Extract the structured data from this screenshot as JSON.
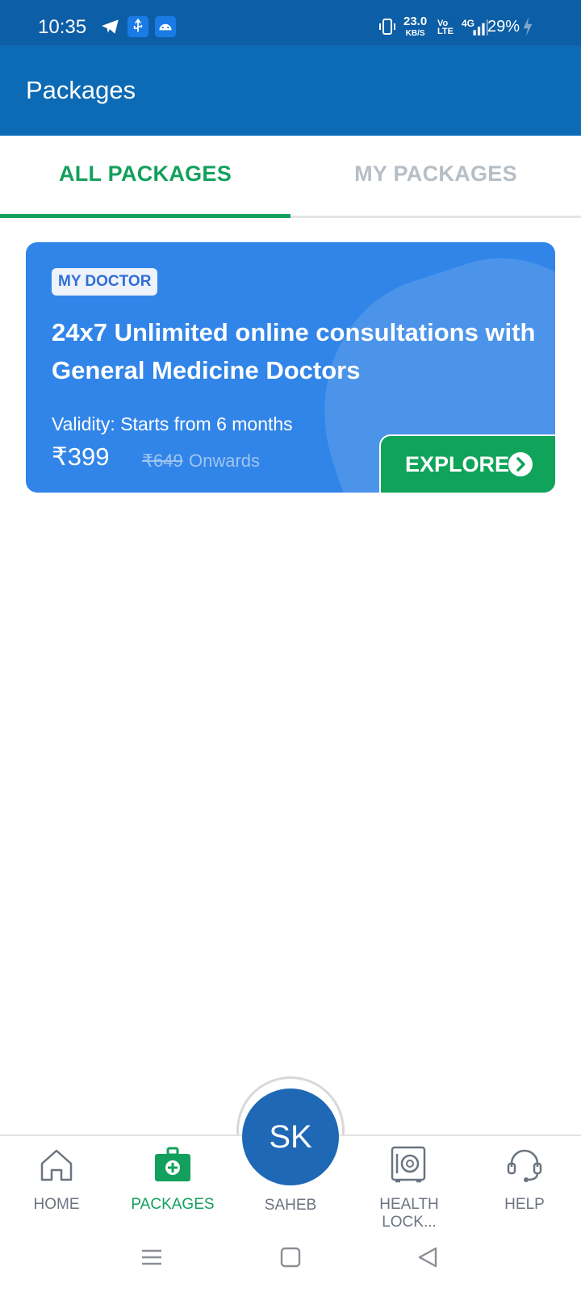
{
  "status_bar": {
    "time": "10:35",
    "data_speed": "23.0",
    "data_unit": "KB/S",
    "network": "4G",
    "battery": "29%",
    "icons": [
      "telegram-icon",
      "usb-icon",
      "android-icon",
      "vibrate-icon",
      "volte-icon",
      "signal-icon",
      "battery-charging-icon"
    ]
  },
  "app_bar": {
    "title": "Packages"
  },
  "tabs": [
    {
      "label": "ALL PACKAGES",
      "active": true
    },
    {
      "label": "MY PACKAGES",
      "active": false
    }
  ],
  "card": {
    "tag": "MY DOCTOR",
    "title": "24x7 Unlimited online consultations with General Medicine Doctors",
    "validity": "Validity: Starts from 6 months",
    "price": "₹399",
    "old_price": "₹649",
    "suffix": "Onwards",
    "cta_label": "EXPLORE"
  },
  "bottom_nav": {
    "items": [
      {
        "label": "HOME",
        "icon": "home-icon",
        "active": false
      },
      {
        "label": "PACKAGES",
        "icon": "medical-bag-icon",
        "active": true
      },
      {
        "label": "HEALTH LOCK...",
        "icon": "locker-icon",
        "active": false
      },
      {
        "label": "HELP",
        "icon": "support-icon",
        "active": false
      }
    ],
    "profile": {
      "initials": "SK",
      "label": "SAHEB"
    }
  },
  "colors": {
    "status_bar": "#0c5ea6",
    "app_bar": "#0d6ab4",
    "accent_green": "#13a05c",
    "card_blue": "#3185e8"
  }
}
